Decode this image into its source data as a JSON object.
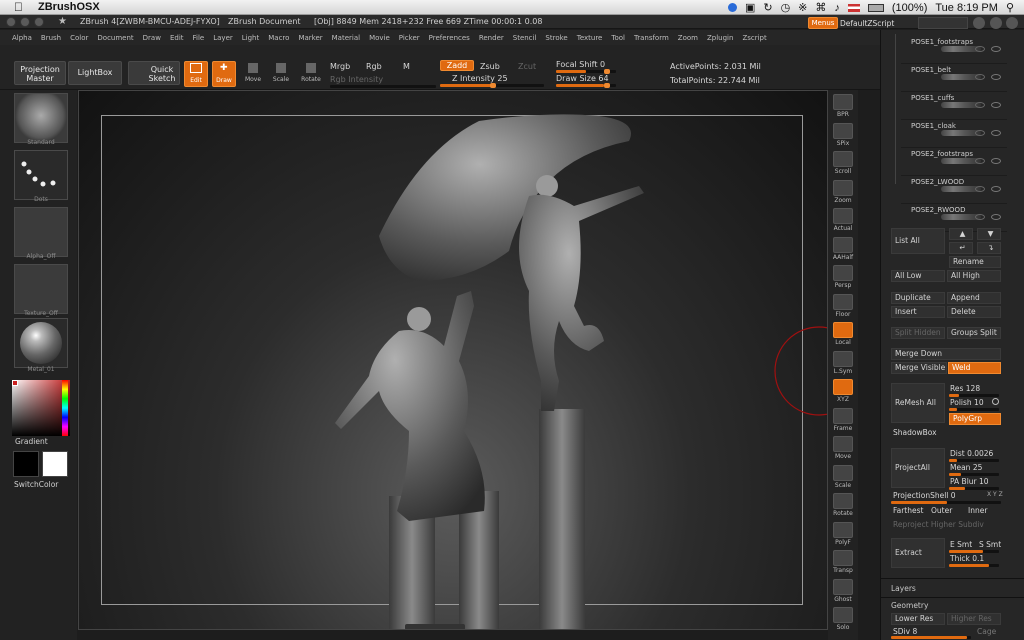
{
  "menubar": {
    "app_name": "ZBrushOSX",
    "battery": "(100%)",
    "clock": "Tue 8:19 PM"
  },
  "titlebar": {
    "title": "ZBrush 4[ZWBM-BMCU-ADEJ-FYXO]",
    "doc": "ZBrush Document",
    "stats": "[Obj] 8849   Mem 2418+232   Free 669   ZTime 00:00:1 0.08",
    "menus_btn": "Menus",
    "script": "DefaultZScript"
  },
  "menus": [
    "Alpha",
    "Brush",
    "Color",
    "Document",
    "Draw",
    "Edit",
    "File",
    "Layer",
    "Light",
    "Macro",
    "Marker",
    "Material",
    "Movie",
    "Picker",
    "Preferences",
    "Render",
    "Stencil",
    "Stroke",
    "Texture",
    "Tool",
    "Transform",
    "Zoom",
    "Zplugin",
    "Zscript"
  ],
  "toolbar": {
    "projection_master": "Projection Master",
    "lightbox": "LightBox",
    "quick_sketch": "Quick Sketch",
    "edit": "Edit",
    "draw": "Draw",
    "move": "Move",
    "scale": "Scale",
    "rotate": "Rotate",
    "mrgb": "Mrgb",
    "rgb": "Rgb",
    "m": "M",
    "rgb_intensity": "Rgb Intensity",
    "zadd": "Zadd",
    "zsub": "Zsub",
    "zcut": "Zcut",
    "z_intensity": "Z Intensity 25",
    "focal_shift": "Focal Shift 0",
    "draw_size": "Draw Size 64",
    "active_points": "ActivePoints: 2.031 Mil",
    "total_points": "TotalPoints: 22.744 Mil"
  },
  "left_shelf": {
    "brush": "Standard",
    "stroke": "Dots",
    "alpha": "Alpha_Off",
    "texture": "Texture_Off",
    "material": "Metal_01",
    "gradient": "Gradient",
    "switch_color": "SwitchColor"
  },
  "right_shelf": [
    "BPR",
    "SPix",
    "Scroll",
    "Zoom",
    "Actual",
    "AAHalf",
    "Persp",
    "Floor",
    "Local",
    "L.Sym",
    "XYZ",
    "Frame",
    "Move",
    "Scale",
    "Rotate",
    "PolyF",
    "Transp",
    "Ghost",
    "Solo"
  ],
  "subtools": [
    "POSE1_footstraps",
    "POSE1_belt",
    "POSE1_cuffs",
    "POSE1_cloak",
    "POSE2_footstraps",
    "POSE2_LWOOD",
    "POSE2_RWOOD"
  ],
  "panel": {
    "list_all": "List All",
    "rename": "Rename",
    "all_low": "All Low",
    "all_high": "All High",
    "duplicate": "Duplicate",
    "append": "Append",
    "insert": "Insert",
    "delete": "Delete",
    "split_hidden": "Split Hidden",
    "groups_split": "Groups Split",
    "merge_down": "Merge Down",
    "merge_visible": "Merge Visible",
    "weld": "Weld",
    "remesh_all": "ReMesh All",
    "res": "Res 128",
    "polish": "Polish 10",
    "polygrp": "PolyGrp",
    "shadowbox": "ShadowBox",
    "project_all": "ProjectAll",
    "dist": "Dist 0.0026",
    "mean": "Mean 25",
    "pa_blur": "PA Blur 10",
    "projection_shell": "ProjectionShell 0",
    "farthest": "Farthest",
    "outer": "Outer",
    "inner": "Inner",
    "reproject": "Reproject Higher Subdiv",
    "extract": "Extract",
    "e_smt": "E Smt",
    "s_smt": "S Smt",
    "thick": "Thick 0.1",
    "layers": "Layers",
    "geometry": "Geometry",
    "lower_res": "Lower Res",
    "higher_res": "Higher Res",
    "sdiv": "SDiv 8",
    "cage": "Cage"
  }
}
